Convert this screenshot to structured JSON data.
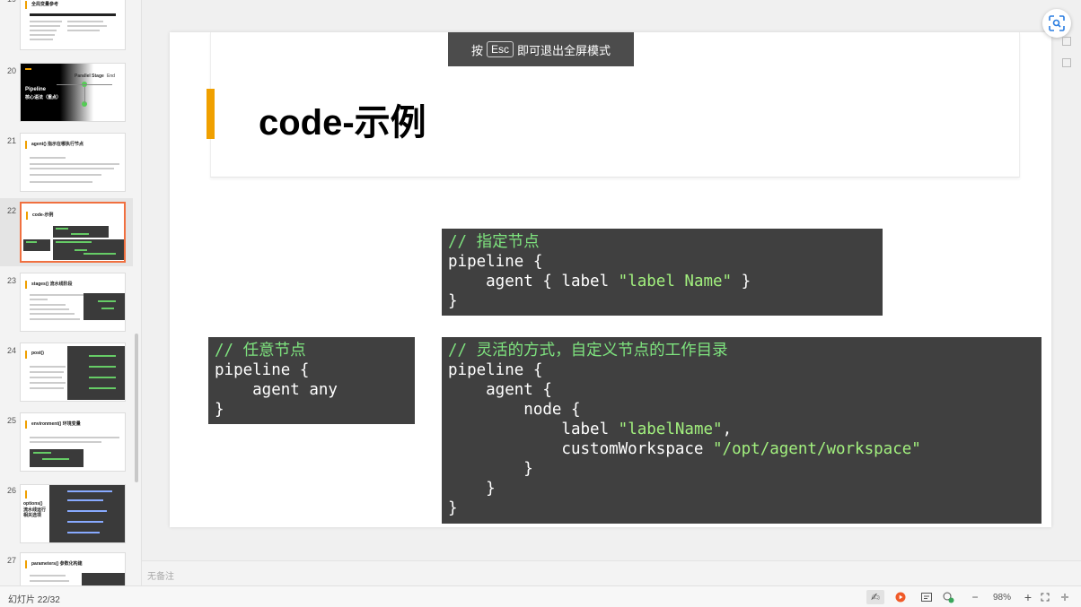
{
  "sidebar": {
    "thumbs": [
      {
        "num": "19",
        "title": "全局变量参考"
      },
      {
        "num": "20",
        "title": "Pipeline",
        "subtitle": "核心语法（重点）",
        "labels": [
          "Parallel Stage",
          "End"
        ]
      },
      {
        "num": "21",
        "title": "agent() 指示在哪执行节点"
      },
      {
        "num": "22",
        "title": "code-示例"
      },
      {
        "num": "23",
        "title": "stages() 流水线阶段"
      },
      {
        "num": "24",
        "title": "post()"
      },
      {
        "num": "25",
        "title": "environment() 环境变量"
      },
      {
        "num": "26",
        "title": "options()",
        "subtitle": "流水线运行相关选项"
      },
      {
        "num": "27",
        "title": "parameters() 参数化构建"
      }
    ]
  },
  "toast": {
    "prefix": "按",
    "key": "Esc",
    "suffix": "即可退出全屏模式"
  },
  "slide": {
    "title": "code-示例",
    "code1": {
      "comment": "// 指定节点",
      "l1": "pipeline {",
      "l2a": "    agent { label ",
      "l2s": "\"label Name\"",
      "l2b": " }",
      "l3": "}"
    },
    "code2": {
      "comment": "// 任意节点",
      "l1": "pipeline {",
      "l2": "    agent any",
      "l3": "}"
    },
    "code3": {
      "comment": "// 灵活的方式，自定义节点的工作目录",
      "l1": "pipeline {",
      "l2": "    agent {",
      "l3": "        node {",
      "l4a": "            label ",
      "l4s": "\"labelName\"",
      "l4b": ",",
      "l5a": "            customWorkspace ",
      "l5s": "\"/opt/agent/workspace\"",
      "l6": "        }",
      "l7": "    }",
      "l8": "}"
    }
  },
  "notes": {
    "placeholder": "无备注"
  },
  "status": {
    "slide_count": "幻灯片 22/32",
    "zoom": "98%"
  }
}
